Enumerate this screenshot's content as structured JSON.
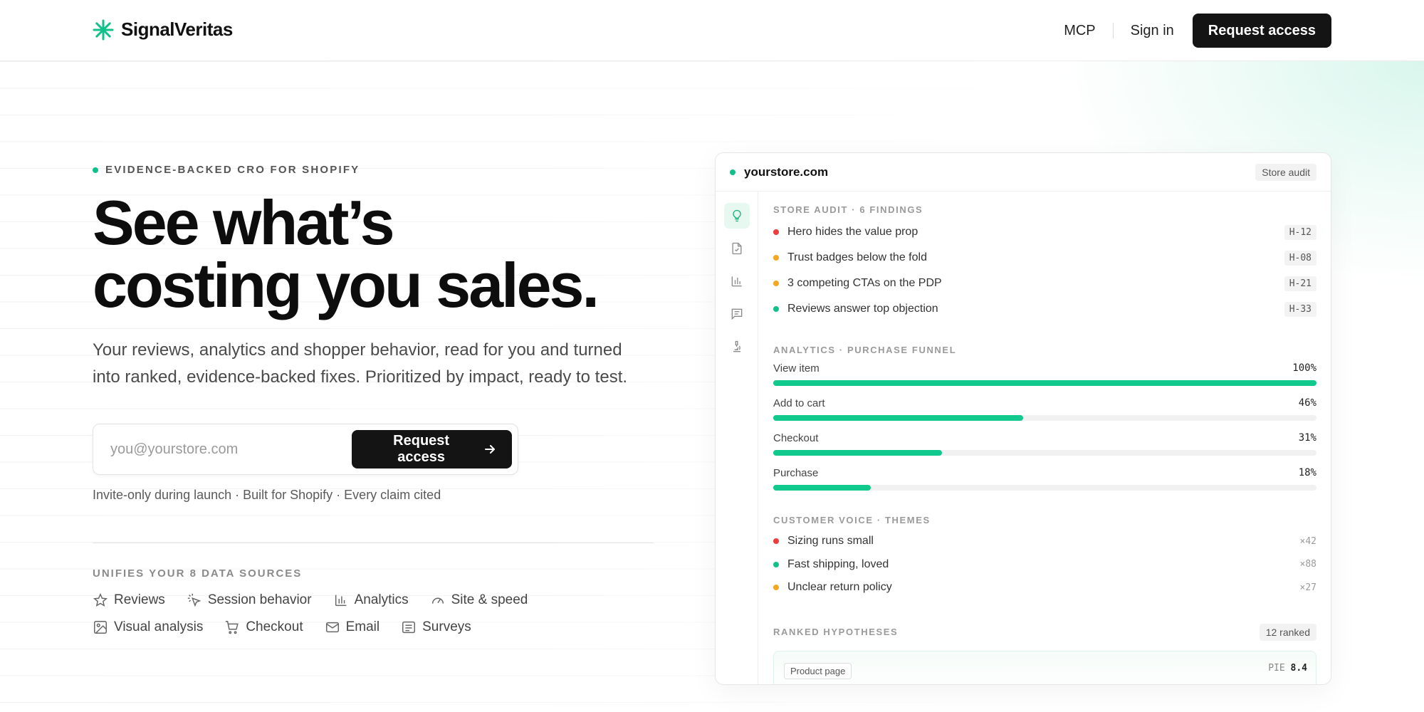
{
  "colors": {
    "accent": "#12c98d",
    "red": "#ef3b3b",
    "orange": "#f5a623",
    "green": "#14c08a",
    "dark": "#141414"
  },
  "header": {
    "brand": "SignalVeritas",
    "nav": {
      "mcp": "MCP",
      "signin": "Sign in",
      "cta": "Request access"
    }
  },
  "hero": {
    "eyebrow": "EVIDENCE-BACKED CRO FOR SHOPIFY",
    "headline_line1": "See what’s",
    "headline_line2": "costing you sales.",
    "subtext": "Your reviews, analytics and shopper behavior, read for you and turned into ranked, evidence-backed fixes. Prioritized by impact, ready to test.",
    "email_placeholder": "you@yourstore.com",
    "cta": "Request access",
    "fineprint": "Invite-only during launch · Built for Shopify · Every claim cited",
    "sources_title": "UNIFIES YOUR 8 DATA SOURCES",
    "sources": [
      {
        "label": "Reviews",
        "icon": "star-icon"
      },
      {
        "label": "Session behavior",
        "icon": "cursor-click-icon"
      },
      {
        "label": "Analytics",
        "icon": "bar-chart-icon"
      },
      {
        "label": "Site & speed",
        "icon": "gauge-icon"
      },
      {
        "label": "Visual analysis",
        "icon": "image-icon"
      },
      {
        "label": "Checkout",
        "icon": "cart-icon"
      },
      {
        "label": "Email",
        "icon": "mail-icon"
      },
      {
        "label": "Surveys",
        "icon": "survey-icon"
      }
    ]
  },
  "card": {
    "domain": "yourstore.com",
    "badge": "Store audit",
    "rail_icons": [
      "lightbulb-icon",
      "file-check-icon",
      "bar-chart-icon",
      "message-icon",
      "microscope-icon"
    ],
    "audit": {
      "title": "STORE AUDIT · 6 FINDINGS",
      "items": [
        {
          "text": "Hero hides the value prop",
          "code": "H-12",
          "severity": "red"
        },
        {
          "text": "Trust badges below the fold",
          "code": "H-08",
          "severity": "orange"
        },
        {
          "text": "3 competing CTAs on the PDP",
          "code": "H-21",
          "severity": "orange"
        },
        {
          "text": "Reviews answer top objection",
          "code": "H-33",
          "severity": "green"
        }
      ]
    },
    "funnel": {
      "title": "ANALYTICS · PURCHASE FUNNEL",
      "steps": [
        {
          "label": "View item",
          "pct": "100%",
          "value": 100
        },
        {
          "label": "Add to cart",
          "pct": "46%",
          "value": 46
        },
        {
          "label": "Checkout",
          "pct": "31%",
          "value": 31
        },
        {
          "label": "Purchase",
          "pct": "18%",
          "value": 18
        }
      ]
    },
    "voice": {
      "title": "CUSTOMER VOICE · THEMES",
      "themes": [
        {
          "text": "Sizing runs small",
          "count": "×42",
          "severity": "red"
        },
        {
          "text": "Fast shipping, loved",
          "count": "×88",
          "severity": "green"
        },
        {
          "text": "Unclear return policy",
          "count": "×27",
          "severity": "orange"
        }
      ]
    },
    "hypotheses": {
      "title": "RANKED HYPOTHESES",
      "badge": "12 ranked",
      "first": {
        "tag": "Product page",
        "pie_label": "PIE",
        "pie_value": "8.4"
      }
    }
  }
}
